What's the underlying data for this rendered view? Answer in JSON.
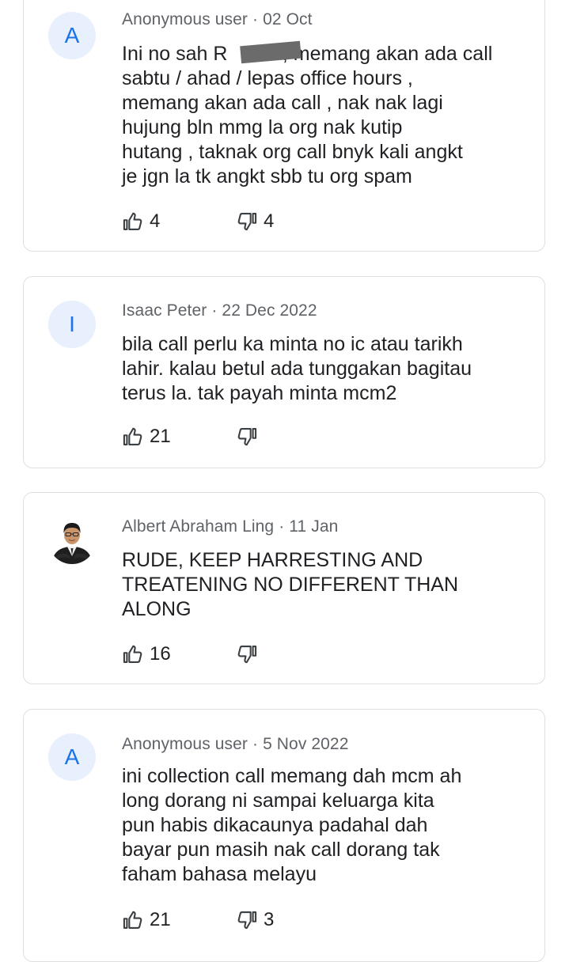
{
  "reviews": [
    {
      "avatar_letter": "A",
      "author": "Anonymous user",
      "date": "02 Oct",
      "text": "Ini no sah R          , memang akan ada call\nsabtu / ahad / lepas office hours ,\nmemang akan ada call , nak nak lagi\nhujung bln mmg la org nak kutip\nhutang , taknak org call bnyk kali angkt\nje jgn la tk angkt sbb tu org spam",
      "likes": "4",
      "dislikes": "4"
    },
    {
      "avatar_letter": "I",
      "author": "Isaac Peter",
      "date": "22 Dec 2022",
      "text": "bila call perlu ka minta no ic atau tarikh\nlahir. kalau betul ada tunggakan bagitau\nterus la. tak payah minta mcm2",
      "likes": "21",
      "dislikes": ""
    },
    {
      "avatar_letter": "",
      "author": "Albert Abraham Ling",
      "date": "11 Jan",
      "text": "RUDE, KEEP HARRESTING AND\nTREATENING NO DIFFERENT THAN\nALONG",
      "likes": "16",
      "dislikes": ""
    },
    {
      "avatar_letter": "A",
      "author": "Anonymous user",
      "date": "5 Nov 2022",
      "text": "ini collection call memang dah mcm ah\nlong dorang ni sampai keluarga kita\npun habis dikacaunya padahal dah\nbayar pun masih nak call dorang tak\nfaham bahasa melayu",
      "likes": "21",
      "dislikes": "3"
    }
  ],
  "separator": "·",
  "icons": {
    "like": "thumb-up-outline-icon",
    "dislike": "thumb-down-outline-icon"
  },
  "colors": {
    "avatar_bg": "#e8f0fe",
    "avatar_letter": "#1a73e8",
    "meta_text": "#5f6368",
    "body_text": "#202124",
    "card_border": "#dcdfe3"
  }
}
